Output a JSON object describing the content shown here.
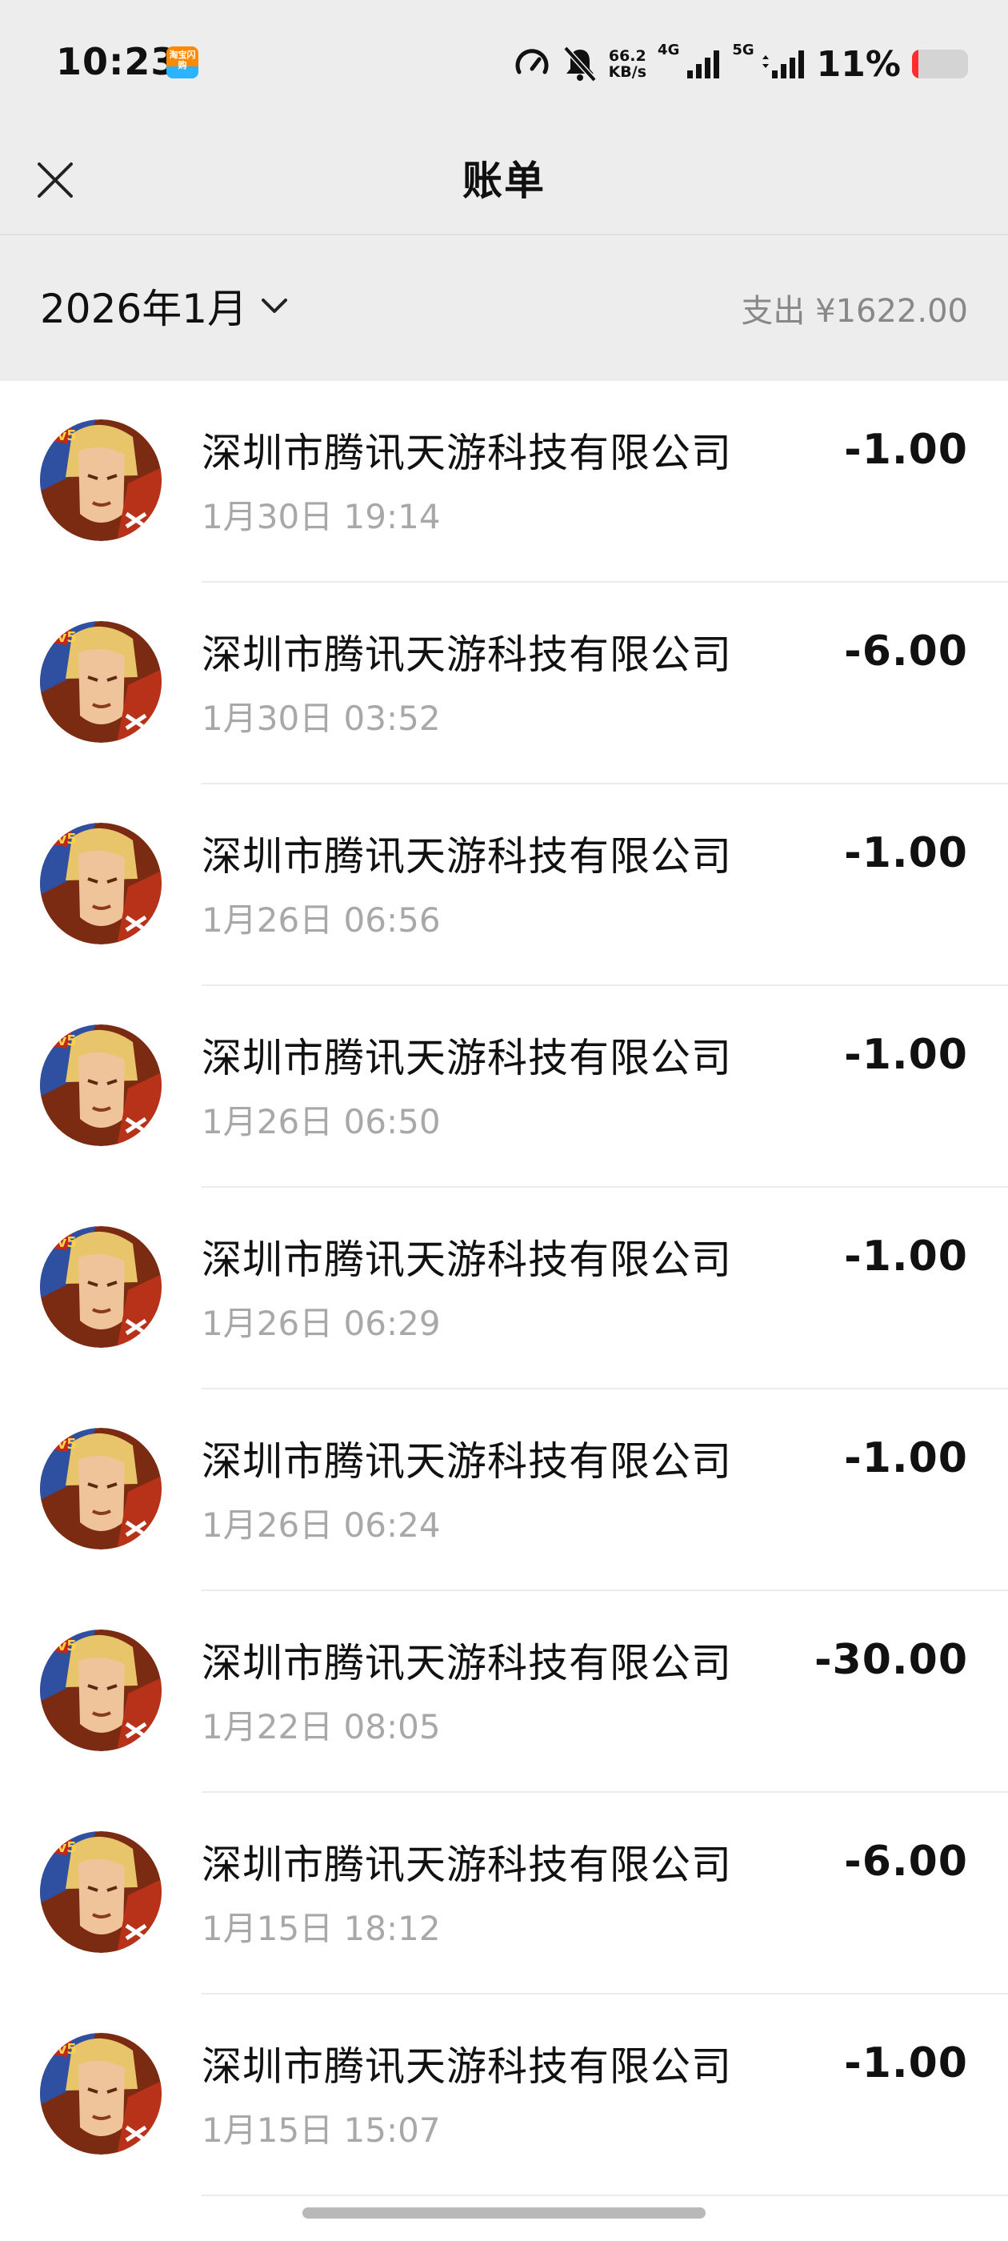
{
  "status_bar": {
    "time": "10:23",
    "app_badge_text": "淘宝闪购",
    "net_speed_value": "66.2",
    "net_speed_unit": "KB/s",
    "net1_label": "4G",
    "net2_label": "5G",
    "battery_percent": "11%",
    "battery_level": 0.11,
    "battery_color": "#ff2d2d",
    "icons": [
      "speedometer-icon",
      "bell-muted-icon",
      "signal-icon",
      "signal-icon",
      "battery-icon"
    ]
  },
  "header": {
    "title": "账单",
    "close_icon": "close-icon"
  },
  "month_bar": {
    "month": "2026年1月",
    "expense_summary": "支出 ¥1622.00"
  },
  "transactions": [
    {
      "merchant": "深圳市腾讯天游科技有限公司",
      "time": "1月30日 19:14",
      "amount": "-1.00"
    },
    {
      "merchant": "深圳市腾讯天游科技有限公司",
      "time": "1月30日 03:52",
      "amount": "-6.00"
    },
    {
      "merchant": "深圳市腾讯天游科技有限公司",
      "time": "1月26日 06:56",
      "amount": "-1.00"
    },
    {
      "merchant": "深圳市腾讯天游科技有限公司",
      "time": "1月26日 06:50",
      "amount": "-1.00"
    },
    {
      "merchant": "深圳市腾讯天游科技有限公司",
      "time": "1月26日 06:29",
      "amount": "-1.00"
    },
    {
      "merchant": "深圳市腾讯天游科技有限公司",
      "time": "1月26日 06:24",
      "amount": "-1.00"
    },
    {
      "merchant": "深圳市腾讯天游科技有限公司",
      "time": "1月22日 08:05",
      "amount": "-30.00"
    },
    {
      "merchant": "深圳市腾讯天游科技有限公司",
      "time": "1月15日 18:12",
      "amount": "-6.00"
    },
    {
      "merchant": "深圳市腾讯天游科技有限公司",
      "time": "1月15日 15:07",
      "amount": "-1.00"
    }
  ],
  "colors": {
    "background": "#ededed",
    "list_background": "#ffffff",
    "secondary_text": "#a8a8a8",
    "summary_text": "#888888"
  }
}
